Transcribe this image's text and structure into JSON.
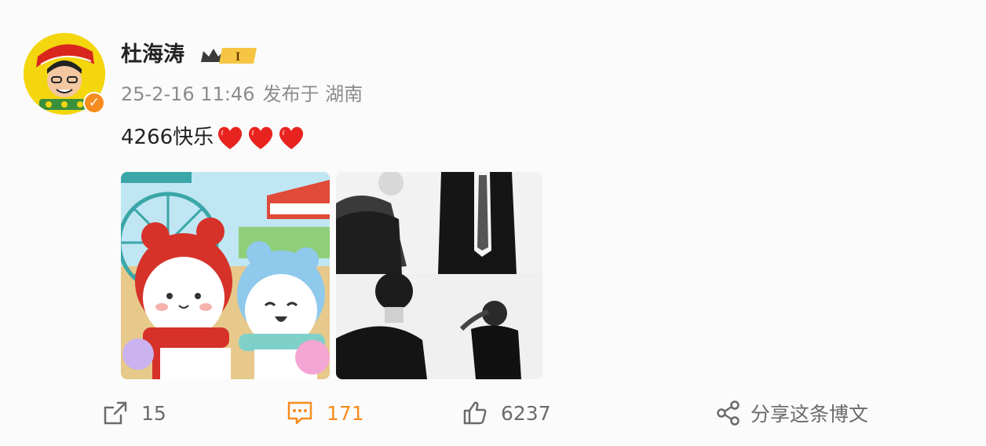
{
  "post": {
    "author": "杜海涛",
    "vip_level": "I",
    "timestamp": "25-2-16 11:46",
    "source": "发布于 湖南",
    "text": "4266快乐",
    "hearts": 3
  },
  "actions": {
    "repost_count": "15",
    "comment_count": "171",
    "like_count": "6237",
    "share_label": "分享这条博文"
  },
  "colors": {
    "accent": "#f78c1e",
    "text": "#222222",
    "muted": "#8c8c8c",
    "heart": "#e8231f"
  },
  "icons": [
    "repost-icon",
    "comment-icon",
    "like-icon",
    "share-icon",
    "verified-icon",
    "crown-icon"
  ]
}
